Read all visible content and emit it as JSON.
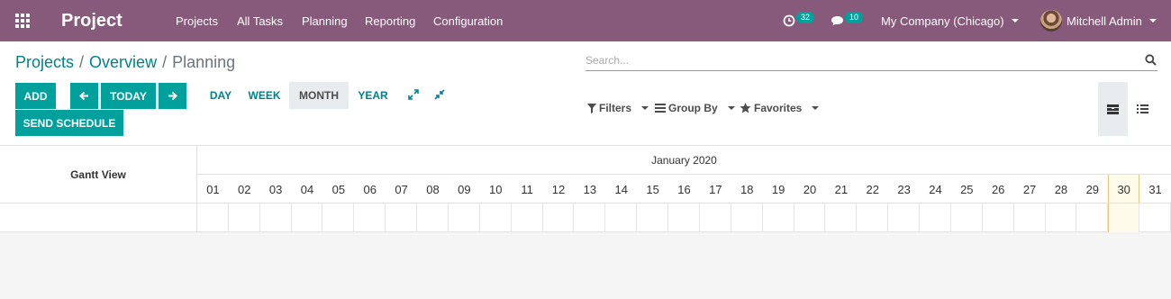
{
  "app": {
    "name": "Project"
  },
  "nav": {
    "menu": [
      "Projects",
      "All Tasks",
      "Planning",
      "Reporting",
      "Configuration"
    ],
    "activities_count": "32",
    "messages_count": "10",
    "company": "My Company (Chicago)",
    "user": "Mitchell Admin"
  },
  "breadcrumb": {
    "crumb1": "Projects",
    "crumb2": "Overview",
    "current": "Planning",
    "separator": "/"
  },
  "search": {
    "placeholder": "Search..."
  },
  "buttons": {
    "add": "ADD",
    "today": "TODAY",
    "send_schedule": "SEND SCHEDULE"
  },
  "scales": {
    "day": "DAY",
    "week": "WEEK",
    "month": "MONTH",
    "year": "YEAR",
    "active": "MONTH"
  },
  "filters": {
    "filters": "Filters",
    "group_by": "Group By",
    "favorites": "Favorites"
  },
  "gantt": {
    "title": "Gantt View",
    "month_label": "January 2020",
    "days": [
      "01",
      "02",
      "03",
      "04",
      "05",
      "06",
      "07",
      "08",
      "09",
      "10",
      "11",
      "12",
      "13",
      "14",
      "15",
      "16",
      "17",
      "18",
      "19",
      "20",
      "21",
      "22",
      "23",
      "24",
      "25",
      "26",
      "27",
      "28",
      "29",
      "30",
      "31"
    ],
    "today": "30"
  },
  "colors": {
    "navbar": "#875a7b",
    "accent": "#00a09d",
    "link": "#00828a",
    "today_highlight": "#fffbeb"
  },
  "icons": [
    "apps-grid-icon",
    "clock-icon",
    "chat-icon",
    "search-icon",
    "arrow-left-icon",
    "arrow-right-icon",
    "expand-icon",
    "collapse-icon",
    "filter-icon",
    "group-by-icon",
    "star-icon",
    "gantt-view-icon",
    "list-view-icon"
  ]
}
